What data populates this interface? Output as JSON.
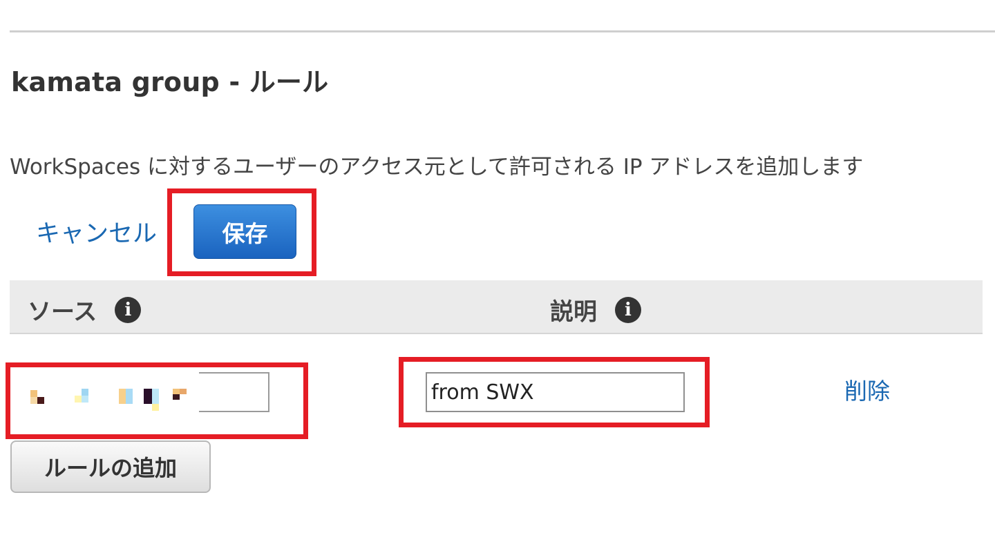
{
  "title": "kamata group - ルール",
  "description": "WorkSpaces に対するユーザーのアクセス元として許可される IP アドレスを追加します",
  "actions": {
    "cancel_label": "キャンセル",
    "save_label": "保存"
  },
  "table": {
    "columns": [
      {
        "label": "ソース",
        "info_icon": "info-icon"
      },
      {
        "label": "説明",
        "info_icon": "info-icon"
      }
    ],
    "rows": [
      {
        "source_value": "",
        "description_value": "from SWX",
        "delete_label": "削除"
      }
    ]
  },
  "add_rule_label": "ルールの追加",
  "colors": {
    "primary_button": "#1a63bf",
    "link": "#1a68b2",
    "highlight": "#e51d25",
    "header_background": "#ebebeb"
  }
}
